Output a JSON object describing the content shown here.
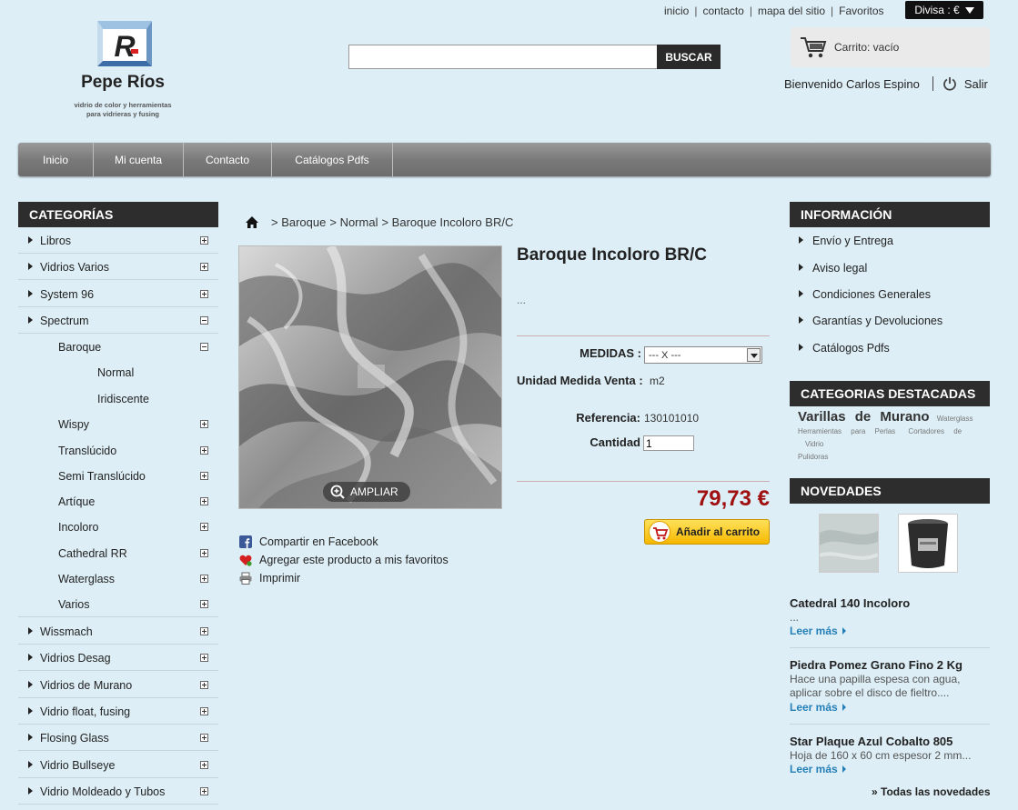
{
  "top_links": [
    "inicio",
    "contacto",
    "mapa del sitio",
    "Favoritos"
  ],
  "divisa": "Divisa : €",
  "logo": {
    "name": "Pepe Ríos",
    "tag_line1": "vidrio de color y herramientas",
    "tag_line2": "para vidrieras y fusing"
  },
  "search": {
    "placeholder": "",
    "button": "BUSCAR"
  },
  "cart": {
    "label": "Carrito: vacío"
  },
  "user": {
    "welcome": "Bienvenido Carlos Espino",
    "logout": "Salir"
  },
  "nav": [
    "Inicio",
    "Mi cuenta",
    "Contacto",
    "Catálogos Pdfs"
  ],
  "categories": {
    "title": "CATEGORÍAS",
    "items": [
      {
        "label": "Libros",
        "level": 0,
        "toggle": "plus"
      },
      {
        "label": "Vidrios Varios",
        "level": 0,
        "toggle": "plus"
      },
      {
        "label": "System 96",
        "level": 0,
        "toggle": "plus"
      },
      {
        "label": "Spectrum",
        "level": 0,
        "toggle": "minus"
      },
      {
        "label": "Baroque",
        "level": 1,
        "toggle": "minus"
      },
      {
        "label": "Normal",
        "level": 2,
        "toggle": ""
      },
      {
        "label": "Iridiscente",
        "level": 2,
        "toggle": ""
      },
      {
        "label": "Wispy",
        "level": 1,
        "toggle": "plus"
      },
      {
        "label": "Translúcido",
        "level": 1,
        "toggle": "plus"
      },
      {
        "label": "Semi Translúcido",
        "level": 1,
        "toggle": "plus"
      },
      {
        "label": "Artíque",
        "level": 1,
        "toggle": "plus"
      },
      {
        "label": "Incoloro",
        "level": 1,
        "toggle": "plus"
      },
      {
        "label": "Cathedral RR",
        "level": 1,
        "toggle": "plus"
      },
      {
        "label": "Waterglass",
        "level": 1,
        "toggle": "plus"
      },
      {
        "label": "Varios",
        "level": 1,
        "toggle": "plus"
      },
      {
        "label": "Wissmach",
        "level": 0,
        "toggle": "plus"
      },
      {
        "label": "Vidrios Desag",
        "level": 0,
        "toggle": "plus"
      },
      {
        "label": "Vidrios de Murano",
        "level": 0,
        "toggle": "plus"
      },
      {
        "label": "Vidrio float, fusing",
        "level": 0,
        "toggle": "plus"
      },
      {
        "label": "Flosing Glass",
        "level": 0,
        "toggle": "plus"
      },
      {
        "label": "Vidrio Bullseye",
        "level": 0,
        "toggle": "plus"
      },
      {
        "label": "Vidrio Moldeado y Tubos",
        "level": 0,
        "toggle": "plus"
      }
    ]
  },
  "breadcrumb": [
    ">  Baroque",
    "> Normal",
    "> Baroque Incoloro BR/C"
  ],
  "product": {
    "title": "Baroque Incoloro BR/C",
    "desc": "...",
    "ampliar": "AMPLIAR",
    "medidas_label": "MEDIDAS :",
    "medidas_value": "--- X ---",
    "unidad_label": "Unidad Medida Venta :",
    "unidad_value": "m2",
    "ref_label": "Referencia:",
    "ref_value": "130101010",
    "cantidad_label": "Cantidad",
    "cantidad_value": "1",
    "price": "79,73 €",
    "add_to_cart": "Añadir al carrito"
  },
  "share": [
    "Compartir en Facebook",
    "Agregar este producto a mis favoritos",
    "Imprimir"
  ],
  "info": {
    "title": "INFORMACIÓN",
    "items": [
      "Envío y Entrega",
      "Aviso legal",
      "Condiciones Generales",
      "Garantías y Devoluciones",
      "Catálogos Pdfs"
    ]
  },
  "featured": {
    "title": "CATEGORIAS DESTACADAS",
    "big": "Varillas de Murano",
    "small": [
      "Waterglass",
      "Herramientas",
      "para",
      "Perlas",
      "Cortadores",
      "de",
      "Vidrio",
      "Pulidoras"
    ]
  },
  "novedades": {
    "title": "NOVEDADES",
    "items": [
      {
        "title": "Catedral 140 Incoloro",
        "text": "...",
        "more": "Leer más"
      },
      {
        "title": "Piedra Pomez Grano Fino 2 Kg",
        "text": "Hace una papilla espesa con agua, aplicar sobre el disco de fieltro....",
        "more": "Leer más"
      },
      {
        "title": "Star Plaque Azul Cobalto 805",
        "text": "Hoja de 160 x 60 cm espesor 2 mm...",
        "more": "Leer más"
      }
    ],
    "all": "» Todas las novedades"
  }
}
